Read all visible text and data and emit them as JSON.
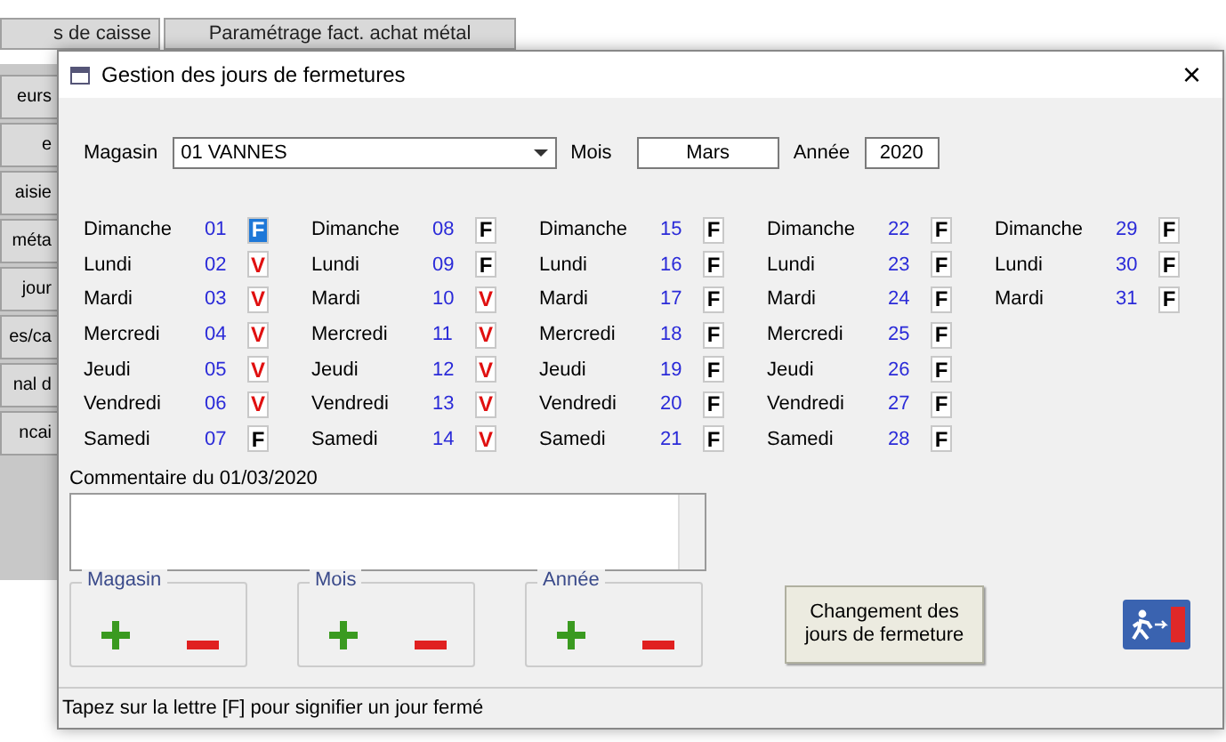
{
  "background_app": {
    "tabs": [
      "s de caisse",
      "Paramétrage fact. achat métal"
    ],
    "side_buttons": [
      "eurs",
      "e",
      "aisie",
      "méta",
      "jour",
      "es/ca",
      "nal d",
      "ncai"
    ]
  },
  "window": {
    "title": "Gestion des jours de fermetures",
    "close": "×"
  },
  "filters": {
    "magasin_label": "Magasin",
    "magasin_value": "01 VANNES",
    "mois_label": "Mois",
    "mois_value": "Mars",
    "annee_label": "Année",
    "annee_value": "2020"
  },
  "weeks": [
    [
      {
        "weekday": "Dimanche",
        "number": "01",
        "mark": "F",
        "kind": "closed",
        "selected": true
      },
      {
        "weekday": "Lundi",
        "number": "02",
        "mark": "V",
        "kind": "open",
        "selected": false
      },
      {
        "weekday": "Mardi",
        "number": "03",
        "mark": "V",
        "kind": "open",
        "selected": false
      },
      {
        "weekday": "Mercredi",
        "number": "04",
        "mark": "V",
        "kind": "open",
        "selected": false
      },
      {
        "weekday": "Jeudi",
        "number": "05",
        "mark": "V",
        "kind": "open",
        "selected": false
      },
      {
        "weekday": "Vendredi",
        "number": "06",
        "mark": "V",
        "kind": "open",
        "selected": false
      },
      {
        "weekday": "Samedi",
        "number": "07",
        "mark": "F",
        "kind": "closed",
        "selected": false
      }
    ],
    [
      {
        "weekday": "Dimanche",
        "number": "08",
        "mark": "F",
        "kind": "closed",
        "selected": false
      },
      {
        "weekday": "Lundi",
        "number": "09",
        "mark": "F",
        "kind": "closed",
        "selected": false
      },
      {
        "weekday": "Mardi",
        "number": "10",
        "mark": "V",
        "kind": "open",
        "selected": false
      },
      {
        "weekday": "Mercredi",
        "number": "11",
        "mark": "V",
        "kind": "open",
        "selected": false
      },
      {
        "weekday": "Jeudi",
        "number": "12",
        "mark": "V",
        "kind": "open",
        "selected": false
      },
      {
        "weekday": "Vendredi",
        "number": "13",
        "mark": "V",
        "kind": "open",
        "selected": false
      },
      {
        "weekday": "Samedi",
        "number": "14",
        "mark": "V",
        "kind": "open",
        "selected": false
      }
    ],
    [
      {
        "weekday": "Dimanche",
        "number": "15",
        "mark": "F",
        "kind": "closed",
        "selected": false
      },
      {
        "weekday": "Lundi",
        "number": "16",
        "mark": "F",
        "kind": "closed",
        "selected": false
      },
      {
        "weekday": "Mardi",
        "number": "17",
        "mark": "F",
        "kind": "closed",
        "selected": false
      },
      {
        "weekday": "Mercredi",
        "number": "18",
        "mark": "F",
        "kind": "closed",
        "selected": false
      },
      {
        "weekday": "Jeudi",
        "number": "19",
        "mark": "F",
        "kind": "closed",
        "selected": false
      },
      {
        "weekday": "Vendredi",
        "number": "20",
        "mark": "F",
        "kind": "closed",
        "selected": false
      },
      {
        "weekday": "Samedi",
        "number": "21",
        "mark": "F",
        "kind": "closed",
        "selected": false
      }
    ],
    [
      {
        "weekday": "Dimanche",
        "number": "22",
        "mark": "F",
        "kind": "closed",
        "selected": false
      },
      {
        "weekday": "Lundi",
        "number": "23",
        "mark": "F",
        "kind": "closed",
        "selected": false
      },
      {
        "weekday": "Mardi",
        "number": "24",
        "mark": "F",
        "kind": "closed",
        "selected": false
      },
      {
        "weekday": "Mercredi",
        "number": "25",
        "mark": "F",
        "kind": "closed",
        "selected": false
      },
      {
        "weekday": "Jeudi",
        "number": "26",
        "mark": "F",
        "kind": "closed",
        "selected": false
      },
      {
        "weekday": "Vendredi",
        "number": "27",
        "mark": "F",
        "kind": "closed",
        "selected": false
      },
      {
        "weekday": "Samedi",
        "number": "28",
        "mark": "F",
        "kind": "closed",
        "selected": false
      }
    ],
    [
      {
        "weekday": "Dimanche",
        "number": "29",
        "mark": "F",
        "kind": "closed",
        "selected": false
      },
      {
        "weekday": "Lundi",
        "number": "30",
        "mark": "F",
        "kind": "closed",
        "selected": false
      },
      {
        "weekday": "Mardi",
        "number": "31",
        "mark": "F",
        "kind": "closed",
        "selected": false
      }
    ]
  ],
  "comment": {
    "label": "Commentaire du 01/03/2020"
  },
  "steppers": [
    {
      "label": "Magasin"
    },
    {
      "label": "Mois"
    },
    {
      "label": "Année"
    }
  ],
  "change_button": "Changement des jours de fermeture",
  "status_bar": "Tapez sur la lettre [F] pour signifier un jour fermé"
}
